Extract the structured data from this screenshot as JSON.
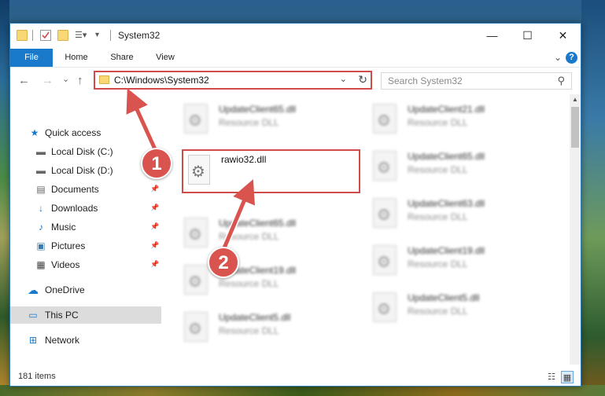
{
  "window": {
    "title": "System32",
    "controls": {
      "minimize": "—",
      "maximize": "☐",
      "close": "✕"
    }
  },
  "ribbon": {
    "tabs": [
      "File",
      "Home",
      "Share",
      "View"
    ],
    "help": "?"
  },
  "navigation": {
    "back": "←",
    "forward": "→",
    "recent": "⌄",
    "up": "↑"
  },
  "address": {
    "path": "C:\\Windows\\System32"
  },
  "search": {
    "placeholder": "Search System32"
  },
  "sidebar": {
    "items": [
      {
        "label": "Quick access",
        "icon": "star-icon"
      },
      {
        "label": "Local Disk (C:)",
        "icon": "drive-icon"
      },
      {
        "label": "Local Disk (D:)",
        "icon": "drive-icon"
      },
      {
        "label": "Documents",
        "icon": "documents-icon"
      },
      {
        "label": "Downloads",
        "icon": "download-icon"
      },
      {
        "label": "Music",
        "icon": "music-icon"
      },
      {
        "label": "Pictures",
        "icon": "pictures-icon"
      },
      {
        "label": "Videos",
        "icon": "videos-icon"
      },
      {
        "label": "OneDrive",
        "icon": "cloud-icon"
      },
      {
        "label": "This PC",
        "icon": "computer-icon"
      },
      {
        "label": "Network",
        "icon": "network-icon"
      }
    ]
  },
  "files": {
    "highlighted": {
      "name": "rawio32.dll"
    },
    "left_column": [
      {
        "name": "UpdateClient65.dll",
        "type": "Resource DLL"
      },
      {
        "name": "UpdateClient65.dll",
        "type": "Resource DLL"
      },
      {
        "name": "UpdateClient19.dll",
        "type": "Resource DLL"
      },
      {
        "name": "UpdateClient5.dll",
        "type": "Resource DLL"
      }
    ],
    "right_column": [
      {
        "name": "UpdateClient21.dll",
        "type": "Resource DLL"
      },
      {
        "name": "UpdateClient65.dll",
        "type": "Resource DLL"
      },
      {
        "name": "UpdateClient63.dll",
        "type": "Resource DLL"
      },
      {
        "name": "UpdateClient19.dll",
        "type": "Resource DLL"
      },
      {
        "name": "UpdateClient5.dll",
        "type": "Resource DLL"
      }
    ]
  },
  "status": {
    "item_count": "181 items"
  },
  "annotations": {
    "step1": "1",
    "step2": "2",
    "accent_color": "#d9534f"
  }
}
